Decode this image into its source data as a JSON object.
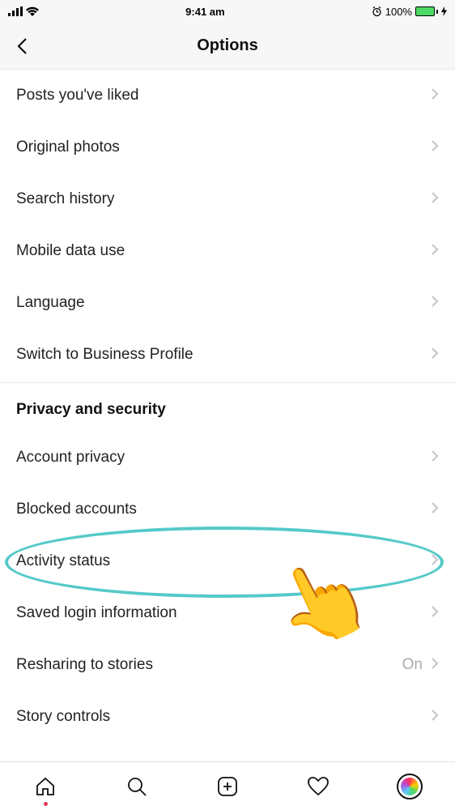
{
  "status": {
    "time": "9:41 am",
    "battery_pct": "100%"
  },
  "header": {
    "title": "Options"
  },
  "section1": {
    "rows": [
      {
        "label": "Posts you've liked"
      },
      {
        "label": "Original photos"
      },
      {
        "label": "Search history"
      },
      {
        "label": "Mobile data use"
      },
      {
        "label": "Language"
      },
      {
        "label": "Switch to Business Profile"
      }
    ]
  },
  "section2": {
    "title": "Privacy and security",
    "rows": [
      {
        "label": "Account privacy"
      },
      {
        "label": "Blocked accounts"
      },
      {
        "label": "Activity status",
        "highlighted": true
      },
      {
        "label": "Saved login information"
      },
      {
        "label": "Resharing to stories",
        "value": "On"
      },
      {
        "label": "Story controls"
      }
    ]
  },
  "annotation": {
    "circled_item": "Activity status"
  }
}
